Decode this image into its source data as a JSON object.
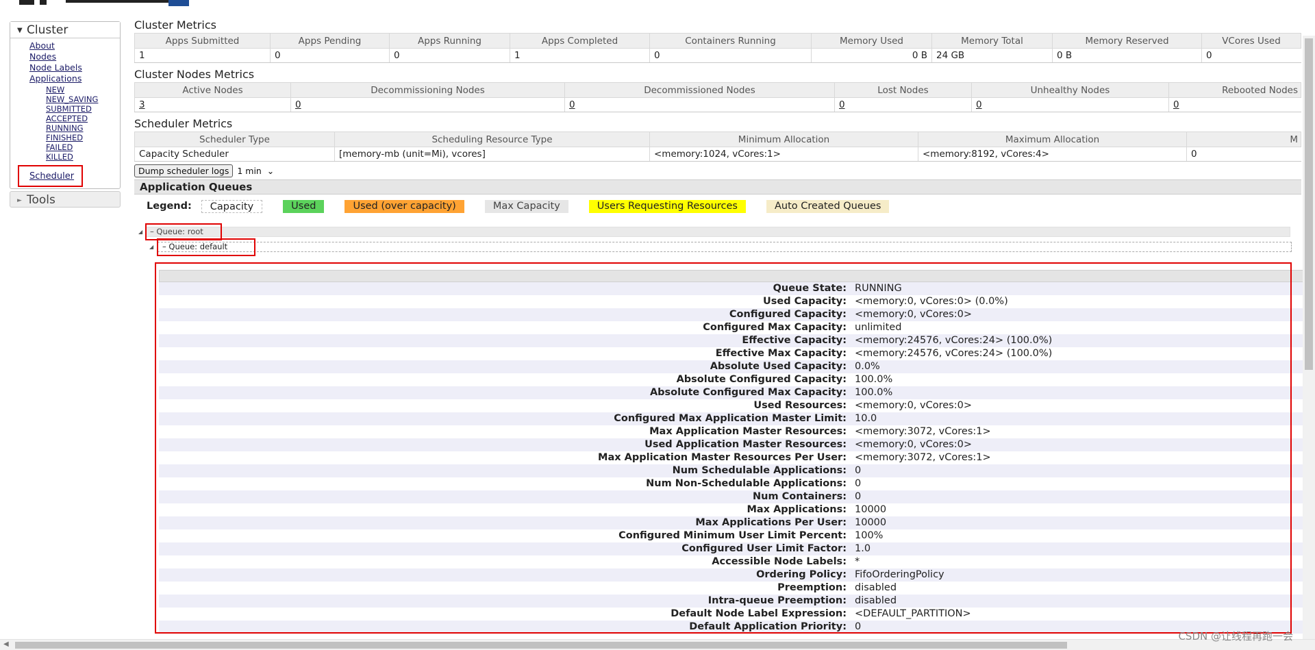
{
  "sidebar": {
    "cluster_label": "Cluster",
    "links": [
      "About",
      "Nodes",
      "Node Labels",
      "Applications"
    ],
    "app_states": [
      "NEW",
      "NEW_SAVING",
      "SUBMITTED",
      "ACCEPTED",
      "RUNNING",
      "FINISHED",
      "FAILED",
      "KILLED"
    ],
    "scheduler_label": "Scheduler",
    "tools_label": "Tools"
  },
  "cluster_metrics": {
    "title": "Cluster Metrics",
    "headers": [
      "Apps Submitted",
      "Apps Pending",
      "Apps Running",
      "Apps Completed",
      "Containers Running",
      "Memory Used",
      "Memory Total",
      "Memory Reserved",
      "VCores Used"
    ],
    "values": [
      "1",
      "0",
      "0",
      "1",
      "0",
      "0 B",
      "24 GB",
      "0 B",
      "0"
    ]
  },
  "cluster_nodes_metrics": {
    "title": "Cluster Nodes Metrics",
    "headers": [
      "Active Nodes",
      "Decommissioning Nodes",
      "Decommissioned Nodes",
      "Lost Nodes",
      "Unhealthy Nodes",
      "Rebooted Nodes"
    ],
    "values": [
      "3",
      "0",
      "0",
      "0",
      "0",
      "0"
    ]
  },
  "scheduler_metrics": {
    "title": "Scheduler Metrics",
    "headers": [
      "Scheduler Type",
      "Scheduling Resource Type",
      "Minimum Allocation",
      "Maximum Allocation",
      "M"
    ],
    "values": [
      "Capacity Scheduler",
      "[memory-mb (unit=Mi), vcores]",
      "<memory:1024, vCores:1>",
      "<memory:8192, vCores:4>",
      "0"
    ]
  },
  "dump": {
    "button_label": "Dump scheduler logs",
    "interval": "1 min"
  },
  "app_queues": {
    "title": "Application Queues",
    "legend_label": "Legend:",
    "legend": [
      {
        "label": "Capacity",
        "bg": "#ffffff",
        "border": "1px dashed #bbb"
      },
      {
        "label": "Used",
        "bg": "#5bd25b",
        "border": "none"
      },
      {
        "label": "Used (over capacity)",
        "bg": "#ffa333",
        "border": "none"
      },
      {
        "label": "Max Capacity",
        "bg": "#e6e6e6",
        "border": "none"
      },
      {
        "label": "Users Requesting Resources",
        "bg": "#ffff00",
        "border": "none"
      },
      {
        "label": "Auto Created Queues",
        "bg": "#f6ecc8",
        "border": "none"
      }
    ],
    "root_queue": "Queue: root",
    "default_queue": "Queue: default"
  },
  "queue_details": [
    {
      "k": "Queue State:",
      "v": "RUNNING"
    },
    {
      "k": "Used Capacity:",
      "v": "<memory:0, vCores:0> (0.0%)"
    },
    {
      "k": "Configured Capacity:",
      "v": "<memory:0, vCores:0>"
    },
    {
      "k": "Configured Max Capacity:",
      "v": "unlimited"
    },
    {
      "k": "Effective Capacity:",
      "v": "<memory:24576, vCores:24> (100.0%)"
    },
    {
      "k": "Effective Max Capacity:",
      "v": "<memory:24576, vCores:24> (100.0%)"
    },
    {
      "k": "Absolute Used Capacity:",
      "v": "0.0%"
    },
    {
      "k": "Absolute Configured Capacity:",
      "v": "100.0%"
    },
    {
      "k": "Absolute Configured Max Capacity:",
      "v": "100.0%"
    },
    {
      "k": "Used Resources:",
      "v": "<memory:0, vCores:0>"
    },
    {
      "k": "Configured Max Application Master Limit:",
      "v": "10.0"
    },
    {
      "k": "Max Application Master Resources:",
      "v": "<memory:3072, vCores:1>"
    },
    {
      "k": "Used Application Master Resources:",
      "v": "<memory:0, vCores:0>"
    },
    {
      "k": "Max Application Master Resources Per User:",
      "v": "<memory:3072, vCores:1>"
    },
    {
      "k": "Num Schedulable Applications:",
      "v": "0"
    },
    {
      "k": "Num Non-Schedulable Applications:",
      "v": "0"
    },
    {
      "k": "Num Containers:",
      "v": "0"
    },
    {
      "k": "Max Applications:",
      "v": "10000"
    },
    {
      "k": "Max Applications Per User:",
      "v": "10000"
    },
    {
      "k": "Configured Minimum User Limit Percent:",
      "v": "100%"
    },
    {
      "k": "Configured User Limit Factor:",
      "v": "1.0"
    },
    {
      "k": "Accessible Node Labels:",
      "v": "*"
    },
    {
      "k": "Ordering Policy:",
      "v": "FifoOrderingPolicy"
    },
    {
      "k": "Preemption:",
      "v": "disabled"
    },
    {
      "k": "Intra-queue Preemption:",
      "v": "disabled"
    },
    {
      "k": "Default Node Label Expression:",
      "v": "<DEFAULT_PARTITION>"
    },
    {
      "k": "Default Application Priority:",
      "v": "0"
    }
  ],
  "watermark": "CSDN @让线程再跑一会"
}
